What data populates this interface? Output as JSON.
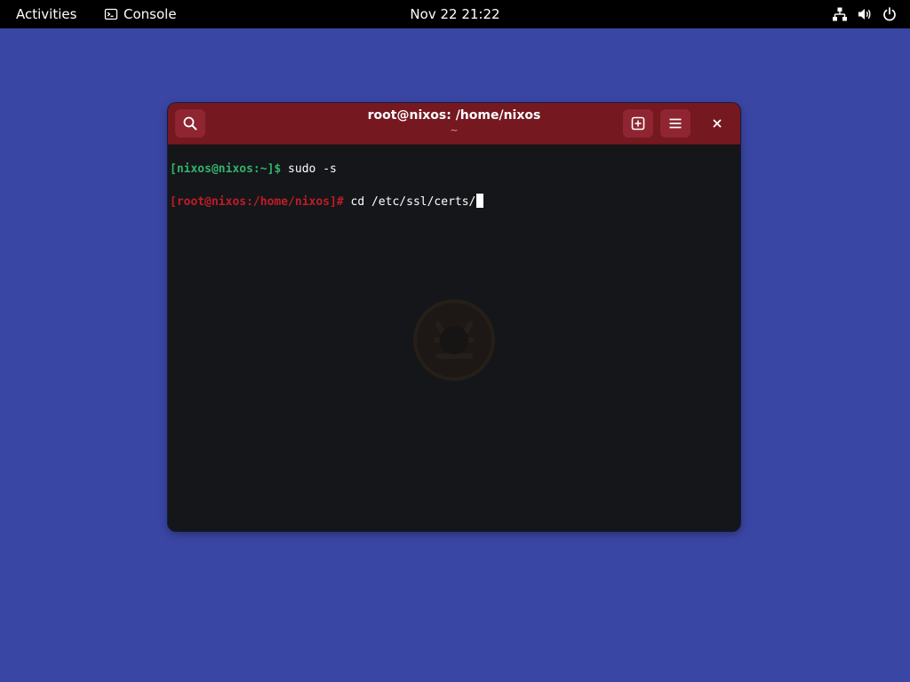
{
  "topbar": {
    "activities_label": "Activities",
    "app_name": "Console",
    "app_icon": "terminal-icon",
    "clock": "Nov 22  21:22",
    "tray_icons": [
      "network-wired-icon",
      "volume-icon",
      "power-icon"
    ]
  },
  "window": {
    "title": "root@nixos: /home/nixos",
    "subtitle": "~",
    "buttons": {
      "search_icon": "search-icon",
      "new_tab_icon": "new-tab-icon",
      "menu_icon": "hamburger-menu-icon",
      "close_icon": "close-icon"
    },
    "header_color": "#751820",
    "terminal_bg": "#151619"
  },
  "terminal": {
    "lines": [
      {
        "prompt": "[nixos@nixos:~]$",
        "command": " sudo -s",
        "prompt_color": "#33b36d"
      },
      {
        "prompt": "[root@nixos:/home/nixos]#",
        "command": " cd /etc/ssl/certs/",
        "prompt_color": "#c01c28"
      }
    ],
    "watermark_icon": "nixos-logo-watermark"
  },
  "colors": {
    "desktop_bg": "#3a46a3",
    "topbar_bg": "#000000"
  }
}
